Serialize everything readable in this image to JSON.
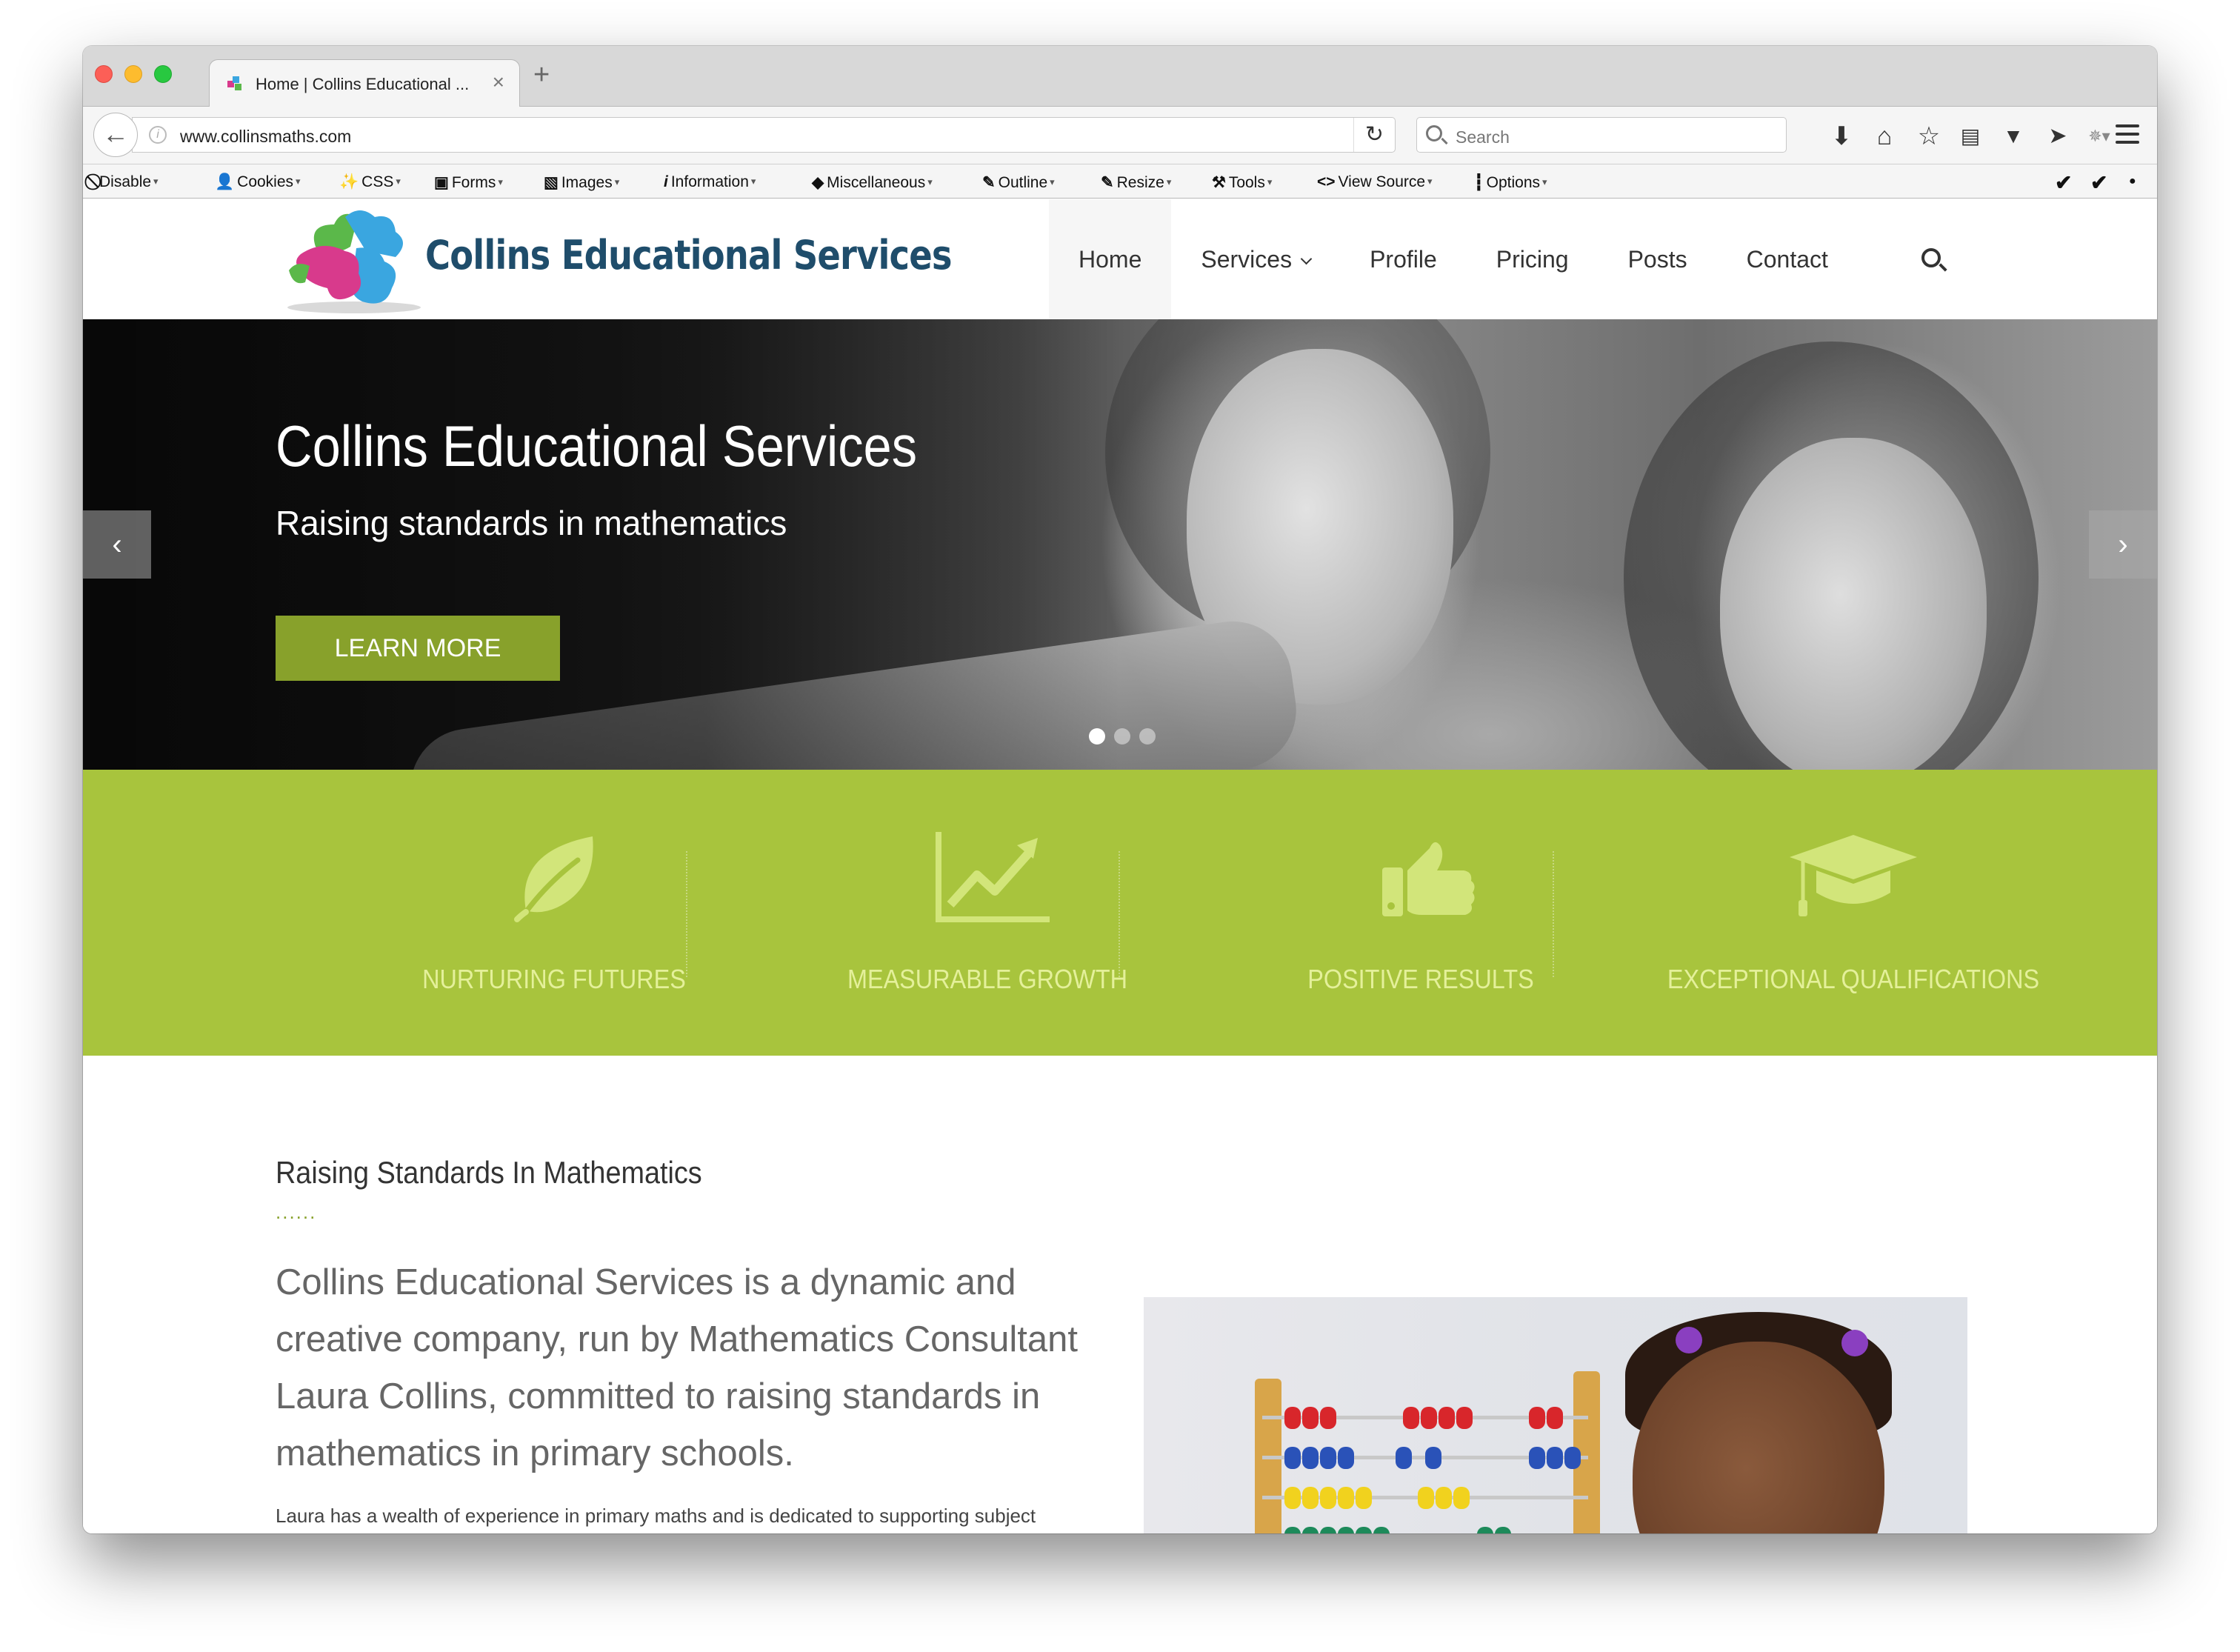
{
  "browser": {
    "tab_title": "Home | Collins Educational ...",
    "tab_close": "×",
    "new_tab": "+",
    "back": "←",
    "url": "www.collinsmaths.com",
    "reload": "↻",
    "search_placeholder": "Search",
    "toolbar_icons": [
      "download-icon",
      "home-icon",
      "bookmark-star-icon",
      "reading-list-icon",
      "pocket-icon",
      "send-icon",
      "extension-icon",
      "overflow-menu-icon"
    ]
  },
  "devbar": {
    "items": [
      {
        "label": "Disable",
        "icon": "⃠"
      },
      {
        "label": "Cookies",
        "icon": "👤"
      },
      {
        "label": "CSS",
        "icon": "✨"
      },
      {
        "label": "Forms",
        "icon": "▣"
      },
      {
        "label": "Images",
        "icon": "▧"
      },
      {
        "label": "Information",
        "icon": "i"
      },
      {
        "label": "Miscellaneous",
        "icon": "◆"
      },
      {
        "label": "Outline",
        "icon": "✎"
      },
      {
        "label": "Resize",
        "icon": "✎"
      },
      {
        "label": "Tools",
        "icon": "⚒"
      },
      {
        "label": "View Source",
        "icon": "<>"
      },
      {
        "label": "Options",
        "icon": "┇"
      }
    ],
    "caret": "▾",
    "check": "✔"
  },
  "site": {
    "logo_text": "Collins Educational Services",
    "nav": {
      "home": "Home",
      "services": "Services",
      "profile": "Profile",
      "pricing": "Pricing",
      "posts": "Posts",
      "contact": "Contact"
    }
  },
  "hero": {
    "title": "Collins Educational Services",
    "subtitle": "Raising standards in mathematics",
    "button": "LEARN MORE",
    "prev": "‹",
    "next": "›",
    "slide_count": 3,
    "active_slide": 1
  },
  "features": [
    {
      "label": "NURTURING FUTURES",
      "icon": "leaf-icon"
    },
    {
      "label": "MEASURABLE GROWTH",
      "icon": "line-chart-icon"
    },
    {
      "label": "POSITIVE RESULTS",
      "icon": "thumbs-up-icon"
    },
    {
      "label": "EXCEPTIONAL QUALIFICATIONS",
      "icon": "graduation-cap-icon"
    }
  ],
  "content": {
    "heading": "Raising Standards In Mathematics",
    "divider": "......",
    "lead": "Collins Educational Services is a dynamic and creative company, run by Mathematics Consultant Laura Collins, committed to raising standards in mathematics in primary schools.",
    "body": "Laura has a wealth of experience in primary maths and is dedicated to supporting subject"
  },
  "colors": {
    "accent_green": "#a8c43d",
    "button_green": "#88a12b",
    "logo_navy": "#1f4d6b"
  }
}
